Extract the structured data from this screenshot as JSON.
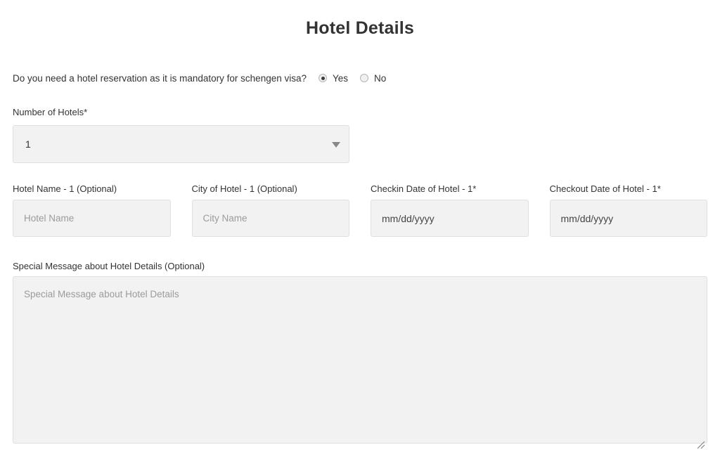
{
  "header": {
    "title": "Hotel Details"
  },
  "reservation_question": {
    "text": "Do you need a hotel reservation as it is mandatory for schengen visa?",
    "options": [
      {
        "label": "Yes",
        "selected": true
      },
      {
        "label": "No",
        "selected": false
      }
    ]
  },
  "number_of_hotels": {
    "label": "Number of Hotels*",
    "value": "1",
    "arrow_icon": "chevron-down-icon"
  },
  "hotel_fields": [
    {
      "label": "Hotel Name - 1 (Optional)",
      "placeholder": "Hotel Name",
      "value": "",
      "type": "text"
    },
    {
      "label": "City of Hotel - 1 (Optional)",
      "placeholder": "City Name",
      "value": "",
      "type": "text"
    },
    {
      "label": "Checkin Date of Hotel - 1*",
      "placeholder": "mm/dd/yyyy",
      "value": "mm/dd/yyyy",
      "type": "date"
    },
    {
      "label": "Checkout Date of Hotel - 1*",
      "placeholder": "mm/dd/yyyy",
      "value": "mm/dd/yyyy",
      "type": "date"
    }
  ],
  "special_message": {
    "label": "Special Message about Hotel Details (Optional)",
    "placeholder": "Special Message about Hotel Details",
    "value": "",
    "resize_handle_icon": "resize-grip-icon"
  },
  "colors": {
    "page_background": "#ffffff",
    "field_background": "#f2f2f2",
    "field_border": "#e0e0e0",
    "text_primary": "#333333",
    "placeholder": "#9b9b9b",
    "arrow": "#888888"
  }
}
